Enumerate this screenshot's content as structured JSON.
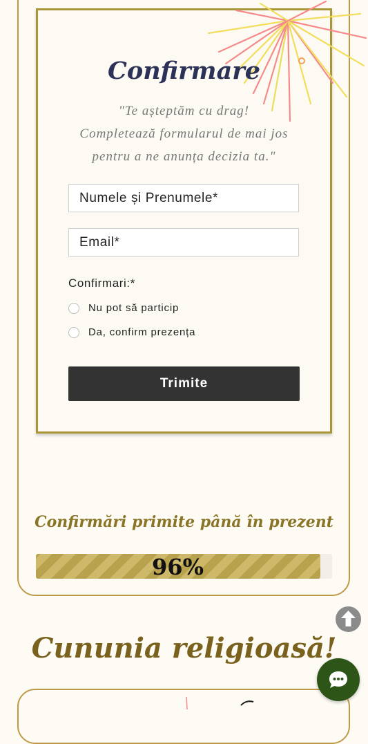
{
  "rsvp": {
    "title": "Confirmare",
    "intro_line_1": "\"Te așteptăm cu drag!",
    "intro_line_2": "Completează formularul de mai jos",
    "intro_line_3": "pentru a ne anunța decizia ta.\"",
    "name_placeholder": "Numele și Prenumele*",
    "email_placeholder": "Email*",
    "confirm_label": "Confirmari:*",
    "options": [
      {
        "label": "Nu pot să particip",
        "selected": false
      },
      {
        "label": "Da, confirm prezența",
        "selected": false
      }
    ],
    "submit_label": "Trimite"
  },
  "stats": {
    "heading": "Confirmări primite până în prezent",
    "progress_text": "96%",
    "progress_value": 0.96
  },
  "section": {
    "heading": "Cununia religioasă!"
  },
  "icons": {
    "scroll_top": "arrow-up-circle-icon",
    "chat": "chat-bubble-icon",
    "decoration": "fireworks-icon"
  },
  "colors": {
    "accent_gold": "#c09a48",
    "title_navy": "#2c3257",
    "button_dark": "#333333",
    "chat_green": "#2d5518"
  }
}
